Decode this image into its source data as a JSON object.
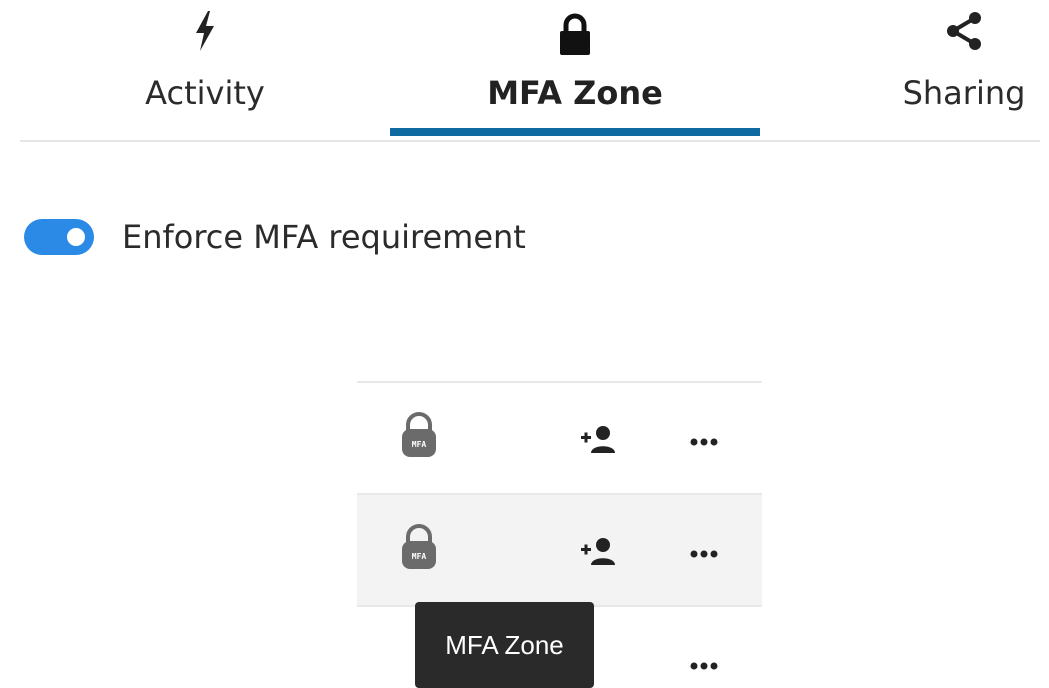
{
  "tabs": [
    {
      "label": "Activity",
      "icon": "lightning-icon",
      "active": false
    },
    {
      "label": "MFA Zone",
      "icon": "lock-icon",
      "active": true
    },
    {
      "label": "Sharing",
      "icon": "share-icon",
      "active": false
    }
  ],
  "toggle": {
    "label": "Enforce MFA requirement",
    "on": true
  },
  "rows": [
    {
      "lock_text": "MFA"
    },
    {
      "lock_text": "MFA"
    },
    {}
  ],
  "tooltip": {
    "text": "MFA Zone"
  },
  "colors": {
    "accent": "#0e6aa0",
    "toggle": "#2b8ae6",
    "tooltip_bg": "#2a2a2a",
    "row_alt": "#f3f3f3"
  }
}
